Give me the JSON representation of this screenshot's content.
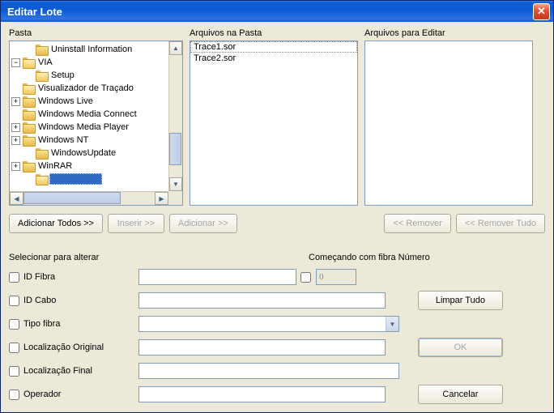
{
  "window": {
    "title": "Editar Lote"
  },
  "columns": {
    "folder_label": "Pasta",
    "files_label": "Arquivos na Pasta",
    "edit_label": "Arquivos para Editar"
  },
  "tree": {
    "items": [
      {
        "label": "Uninstall Information",
        "indent": 1,
        "expander": "none"
      },
      {
        "label": "VIA",
        "indent": 0,
        "expander": "minus",
        "open": true
      },
      {
        "label": "Setup",
        "indent": 1,
        "expander": "none",
        "open": true
      },
      {
        "label": "Visualizador de Traçado",
        "indent": 0,
        "expander": "none",
        "open": true
      },
      {
        "label": "Windows Live",
        "indent": 0,
        "expander": "plus"
      },
      {
        "label": "Windows Media Connect",
        "indent": 0,
        "expander": "none"
      },
      {
        "label": "Windows Media Player",
        "indent": 0,
        "expander": "plus"
      },
      {
        "label": "Windows NT",
        "indent": 0,
        "expander": "plus"
      },
      {
        "label": "WindowsUpdate",
        "indent": 1,
        "expander": "none"
      },
      {
        "label": "WinRAR",
        "indent": 0,
        "expander": "plus"
      }
    ],
    "selected_blank": true
  },
  "files_in_folder": [
    "Trace1.sor",
    "Trace2.sor"
  ],
  "files_to_edit": [],
  "buttons": {
    "add_all": "Adicionar Todos >>",
    "insert": "Inserir >>",
    "add": "Adicionar >>",
    "remove": "<< Remover",
    "remove_all": "<< Remover Tudo",
    "clear_all": "Limpar Tudo",
    "ok": "OK",
    "cancel": "Cancelar"
  },
  "form": {
    "section_label": "Selecionar para alterar",
    "start_label": "Começando com fibra Número",
    "start_value": "0",
    "fields": {
      "id_fibra": "ID Fibra",
      "id_cabo": "ID Cabo",
      "tipo_fibra": "Tipo fibra",
      "loc_orig": "Localização Original",
      "loc_final": "Localização Final",
      "operador": "Operador"
    }
  }
}
